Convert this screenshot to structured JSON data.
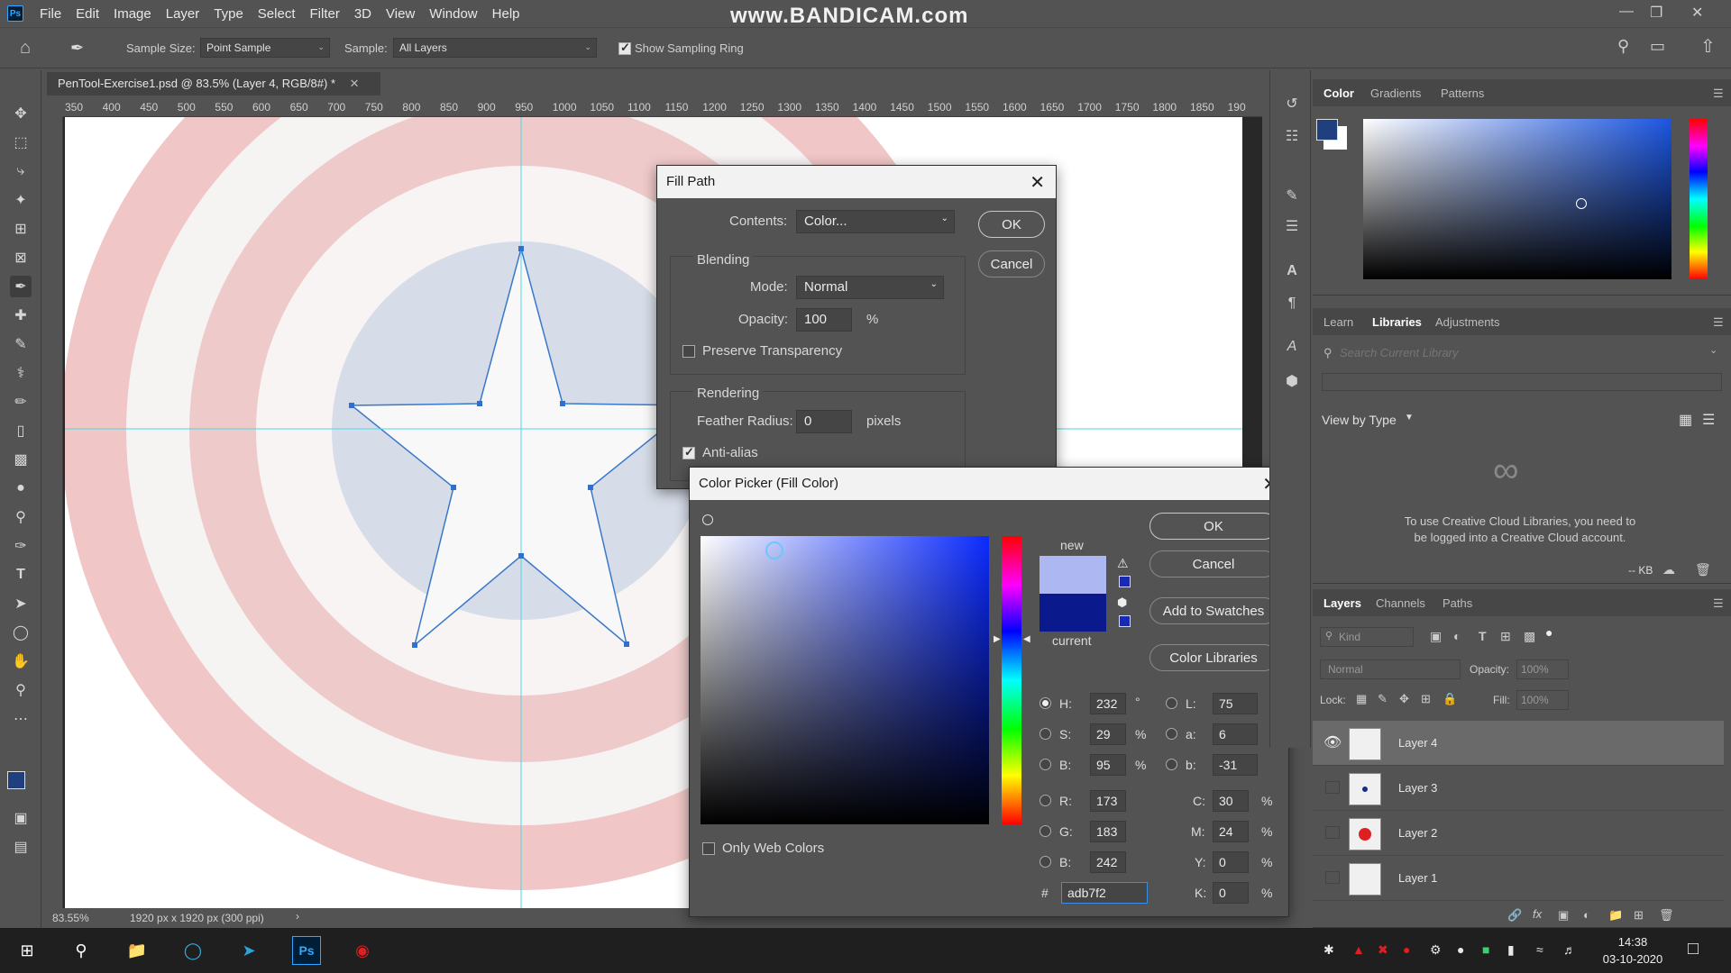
{
  "menubar": {
    "logo": "Ps",
    "items": [
      "File",
      "Edit",
      "Image",
      "Layer",
      "Type",
      "Select",
      "Filter",
      "3D",
      "View",
      "Window",
      "Help"
    ],
    "watermark": "www.BANDICAM.com"
  },
  "options": {
    "sample_size_label": "Sample Size:",
    "sample_size_value": "Point Sample",
    "sample_label": "Sample:",
    "sample_value": "All Layers",
    "show_sampling_ring": "Show Sampling Ring",
    "show_sampling_ring_checked": true
  },
  "document": {
    "tab_title": "PenTool-Exercise1.psd @ 83.5% (Layer 4, RGB/8#) *",
    "ruler_ticks": [
      "350",
      "400",
      "450",
      "500",
      "550",
      "600",
      "650",
      "700",
      "750",
      "800",
      "850",
      "900",
      "950",
      "1000",
      "1050",
      "1100",
      "1150",
      "1200",
      "1250",
      "1300",
      "1350",
      "1400",
      "1450",
      "1500",
      "1550",
      "1600",
      "1650",
      "1700",
      "1750",
      "1800",
      "1850",
      "190"
    ],
    "zoom": "83.55%",
    "doc_info": "1920 px x 1920 px (300 ppi)"
  },
  "fill_path": {
    "title": "Fill Path",
    "contents_label": "Contents:",
    "contents_value": "Color...",
    "ok": "OK",
    "cancel": "Cancel",
    "blending_label": "Blending",
    "mode_label": "Mode:",
    "mode_value": "Normal",
    "opacity_label": "Opacity:",
    "opacity_value": "100",
    "opacity_unit": "%",
    "preserve_transparency": "Preserve Transparency",
    "rendering_label": "Rendering",
    "feather_label": "Feather Radius:",
    "feather_value": "0",
    "feather_unit": "pixels",
    "anti_alias": "Anti-alias"
  },
  "color_picker": {
    "title": "Color Picker (Fill Color)",
    "ok": "OK",
    "cancel": "Cancel",
    "add_to_swatches": "Add to Swatches",
    "color_libraries": "Color Libraries",
    "new_label": "new",
    "current_label": "current",
    "new_color": "#adb7f2",
    "current_color": "#0a1a8c",
    "only_web_colors": "Only Web Colors",
    "fields": {
      "H": {
        "label": "H:",
        "value": "232",
        "unit": "°"
      },
      "S": {
        "label": "S:",
        "value": "29",
        "unit": "%"
      },
      "Bv": {
        "label": "B:",
        "value": "95",
        "unit": "%"
      },
      "R": {
        "label": "R:",
        "value": "173",
        "unit": ""
      },
      "G": {
        "label": "G:",
        "value": "183",
        "unit": ""
      },
      "Bc": {
        "label": "B:",
        "value": "242",
        "unit": ""
      },
      "L": {
        "label": "L:",
        "value": "75",
        "unit": ""
      },
      "a": {
        "label": "a:",
        "value": "6",
        "unit": ""
      },
      "b": {
        "label": "b:",
        "value": "-31",
        "unit": ""
      },
      "C": {
        "label": "C:",
        "value": "30",
        "unit": "%"
      },
      "M": {
        "label": "M:",
        "value": "24",
        "unit": "%"
      },
      "Y": {
        "label": "Y:",
        "value": "0",
        "unit": "%"
      },
      "K": {
        "label": "K:",
        "value": "0",
        "unit": "%"
      }
    },
    "hex_label": "#",
    "hex_value": "adb7f2"
  },
  "color_panel": {
    "tabs": [
      "Color",
      "Gradients",
      "Patterns"
    ],
    "foreground": "#1f3f7f",
    "background": "#ffffff"
  },
  "libraries_panel": {
    "tabs": [
      "Learn",
      "Libraries",
      "Adjustments"
    ],
    "search_placeholder": "Search Current Library",
    "view_by": "View by Type",
    "message": "To use Creative Cloud Libraries, you need to be logged into a Creative Cloud account.",
    "kb": "-- KB"
  },
  "layers_panel": {
    "tabs": [
      "Layers",
      "Channels",
      "Paths"
    ],
    "kind_placeholder": "Kind",
    "blend_mode": "Normal",
    "opacity_label": "Opacity:",
    "opacity_value": "100%",
    "lock_label": "Lock:",
    "fill_label": "Fill:",
    "fill_value": "100%",
    "layers": [
      {
        "name": "Layer 4",
        "visible": true,
        "selected": true
      },
      {
        "name": "Layer 3",
        "visible": false,
        "selected": false
      },
      {
        "name": "Layer 2",
        "visible": false,
        "selected": false
      },
      {
        "name": "Layer 1",
        "visible": false,
        "selected": false
      }
    ]
  },
  "taskbar": {
    "time": "14:38",
    "date": "03-10-2020"
  }
}
